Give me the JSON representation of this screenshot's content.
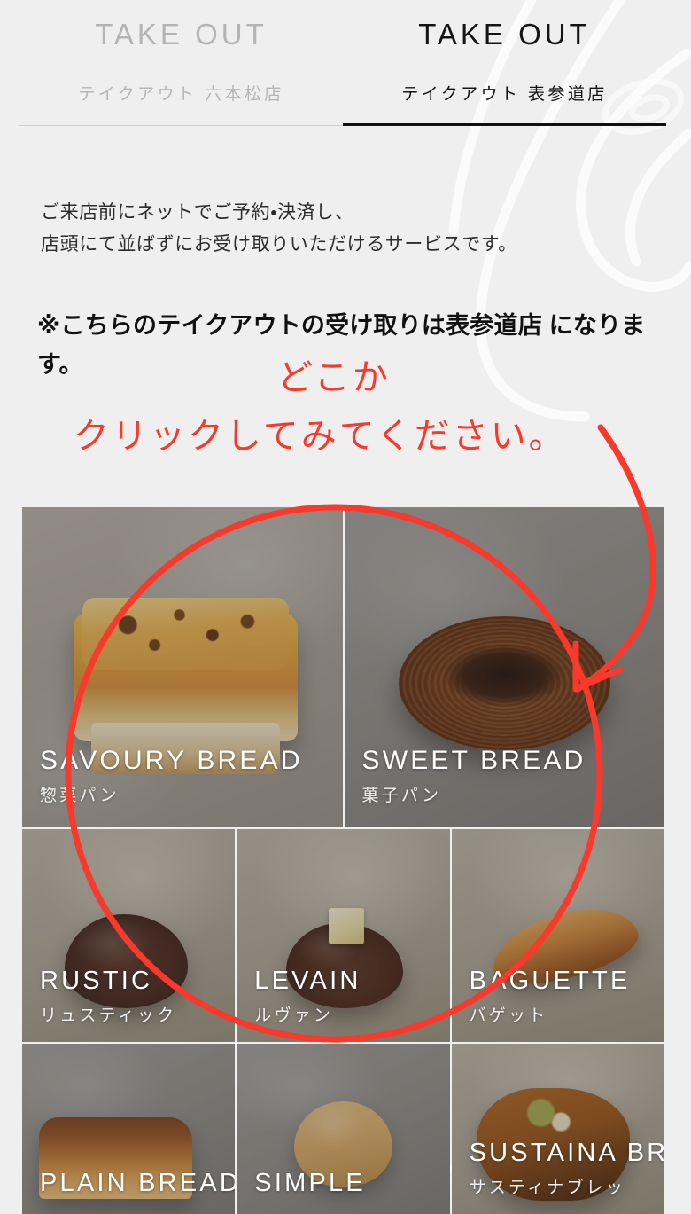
{
  "colors": {
    "page_background": "#efefef",
    "annotation_red": "#f8392b",
    "active_tab_text": "#141414",
    "inactive_tab_text": "#b4b4b4",
    "tile_label": "#ffffff"
  },
  "tabs": [
    {
      "id": "takeout-ropponmatsu",
      "title_en": "TAKE OUT",
      "title_ja": "テイクアウト 六本松店",
      "active": false
    },
    {
      "id": "takeout-omotesando",
      "title_en": "TAKE OUT",
      "title_ja": "テイクアウト 表参道店",
      "active": true
    }
  ],
  "lead": {
    "line1": "ご来店前にネットでご予約・決済し、",
    "line2": "店頭にて並ばずにお受け取りいただけるサービスです。"
  },
  "notice": {
    "line1": "※こちらのテイクアウトの受け取りは表参道店",
    "line2": "になります。"
  },
  "annotation": {
    "text1": "どこか",
    "text2": "クリックしてみてください。",
    "shape": "red-ellipse-and-arrow"
  },
  "categories": {
    "row1": [
      {
        "name_en": "SAVOURY BREAD",
        "name_ja": "惣菜パン"
      },
      {
        "name_en": "SWEET BREAD",
        "name_ja": "菓子パン"
      }
    ],
    "row2": [
      {
        "name_en": "RUSTIC",
        "name_ja": "リュスティック"
      },
      {
        "name_en": "LEVAIN",
        "name_ja": "ルヴァン"
      },
      {
        "name_en": "BAGUETTE",
        "name_ja": "バゲット"
      }
    ],
    "row3": [
      {
        "name_en": "PLAIN BREAD",
        "name_ja": ""
      },
      {
        "name_en": "SIMPLE",
        "name_ja": ""
      },
      {
        "name_en": "SUSTAINA BREAD",
        "name_ja": "サスティナブレッ"
      }
    ]
  }
}
